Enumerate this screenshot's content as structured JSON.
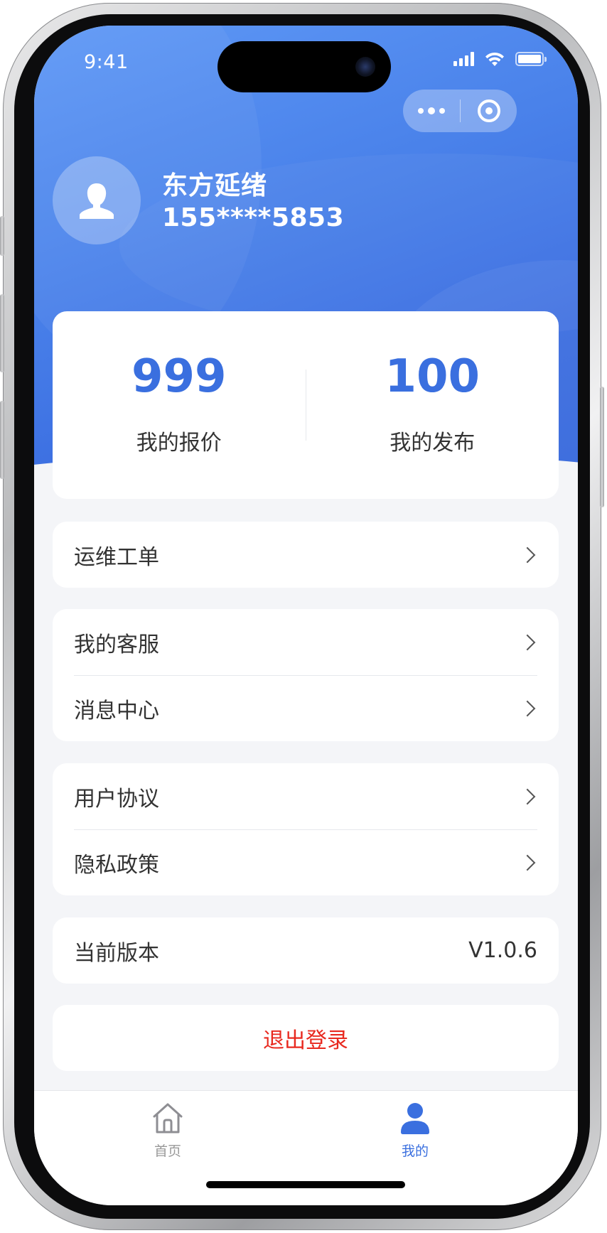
{
  "status_bar": {
    "time": "9:41"
  },
  "profile": {
    "name": "东方延绪",
    "phone": "155****5853"
  },
  "stats": [
    {
      "value": "999",
      "label": "我的报价"
    },
    {
      "value": "100",
      "label": "我的发布"
    }
  ],
  "menu": {
    "group1": [
      {
        "label": "运维工单"
      }
    ],
    "group2": [
      {
        "label": "我的客服"
      },
      {
        "label": "消息中心"
      }
    ],
    "group3": [
      {
        "label": "用户协议"
      },
      {
        "label": "隐私政策"
      }
    ],
    "version": {
      "label": "当前版本",
      "value": "V1.0.6"
    },
    "logout": {
      "label": "退出登录"
    }
  },
  "tabbar": {
    "items": [
      {
        "label": "首页"
      },
      {
        "label": "我的"
      }
    ],
    "active_color": "#3a6fdf",
    "inactive_color": "#999999"
  },
  "colors": {
    "accent": "#3a6fdf",
    "danger": "#e8291f",
    "background": "#f4f5f8"
  }
}
